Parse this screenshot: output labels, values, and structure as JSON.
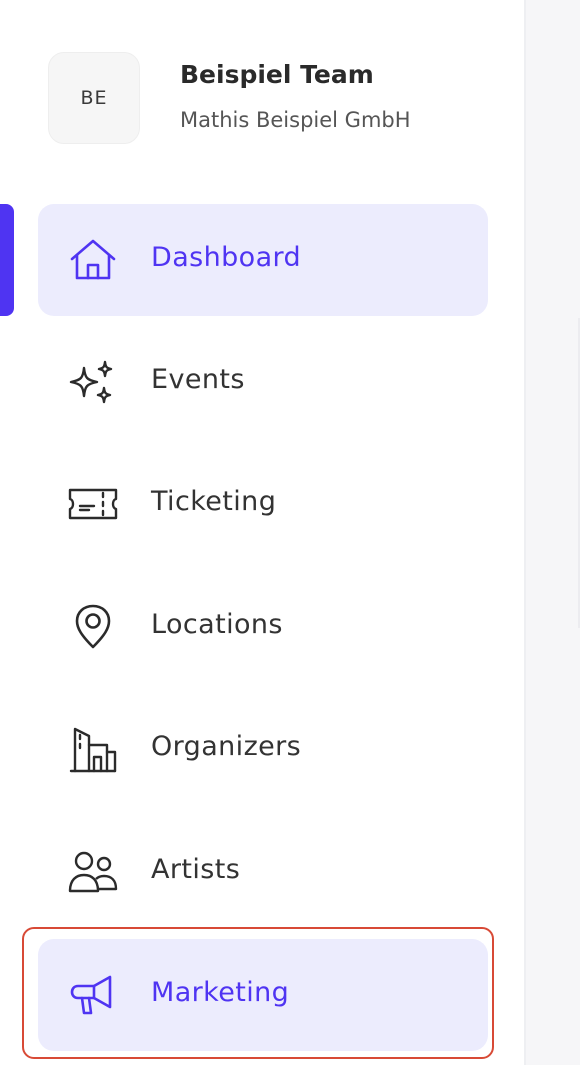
{
  "team": {
    "avatar_initials": "BE",
    "name": "Beispiel Team",
    "company": "Mathis Beispiel GmbH"
  },
  "nav": {
    "items": [
      {
        "label": "Dashboard",
        "icon": "home-icon",
        "active": true
      },
      {
        "label": "Events",
        "icon": "sparkles-icon",
        "active": false
      },
      {
        "label": "Ticketing",
        "icon": "ticket-icon",
        "active": false
      },
      {
        "label": "Locations",
        "icon": "map-pin-icon",
        "active": false
      },
      {
        "label": "Organizers",
        "icon": "building-icon",
        "active": false
      },
      {
        "label": "Artists",
        "icon": "users-icon",
        "active": false
      },
      {
        "label": "Marketing",
        "icon": "megaphone-icon",
        "active": false,
        "highlighted": true
      }
    ]
  },
  "colors": {
    "accent": "#4f34f2",
    "active_background": "#ececfd",
    "highlight_frame": "#d84a36"
  }
}
